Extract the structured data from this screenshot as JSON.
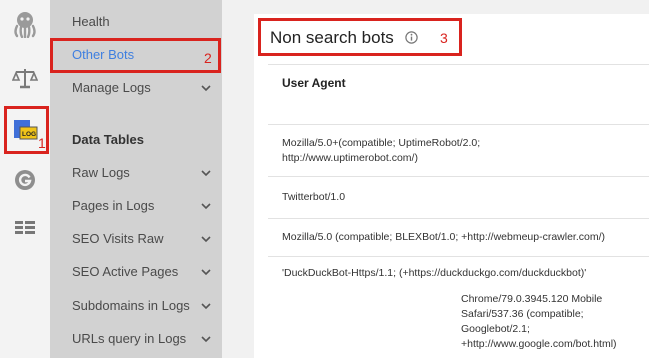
{
  "rail": {
    "icons": [
      "octopus-icon",
      "scales-icon",
      "log-icon",
      "google-icon",
      "data-table-icon"
    ],
    "log_badge": "LOG",
    "marker": "1"
  },
  "nav": {
    "items": [
      {
        "label": "Health",
        "expandable": false
      },
      {
        "label": "Other Bots",
        "expandable": false,
        "active": true
      },
      {
        "label": "Manage Logs",
        "expandable": true
      }
    ],
    "marker": "2",
    "section_title": "Data Tables",
    "data_tables": [
      {
        "label": "Raw Logs"
      },
      {
        "label": "Pages in Logs"
      },
      {
        "label": "SEO Visits Raw"
      },
      {
        "label": "SEO Active Pages"
      },
      {
        "label": "Subdomains in Logs"
      },
      {
        "label": "URLs query in Logs"
      }
    ]
  },
  "main": {
    "title": "Non search bots",
    "marker": "3",
    "column_header": "User Agent",
    "rows": [
      {
        "line1": "Mozilla/5.0+(compatible; UptimeRobot/2.0;",
        "line2": "http://www.uptimerobot.com/)"
      },
      {
        "line1": "Twitterbot/1.0"
      },
      {
        "line1": "Mozilla/5.0 (compatible; BLEXBot/1.0; +http://webmeup-crawler.com/)"
      },
      {
        "line1": "'DuckDuckBot-Https/1.1; (+https://duckduckgo.com/duckduckbot)'"
      },
      {
        "line1": "Chrome/79.0.3945.120 Mobile",
        "line2": "Safari/537.36 (compatible;",
        "line3": "Googlebot/2.1;",
        "line4": "+http://www.google.com/bot.html)"
      }
    ]
  },
  "colors": {
    "highlight": "#d9231e",
    "active_link": "#3f7fe0",
    "nav_bg": "#d2d2d2"
  }
}
